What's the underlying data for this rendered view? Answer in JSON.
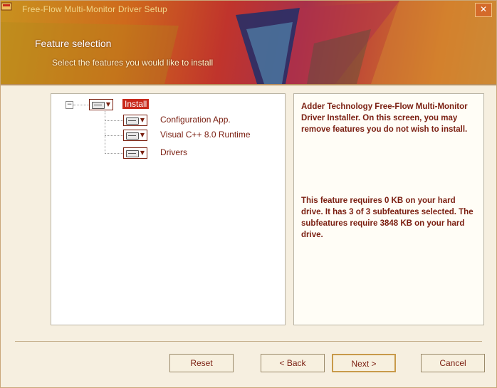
{
  "window": {
    "title": "Free-Flow Multi-Monitor Driver Setup",
    "close_label": "✕"
  },
  "banner": {
    "title": "Feature selection",
    "subtitle": "Select the features you would like to install"
  },
  "tree": {
    "root_label": "Install",
    "items": [
      {
        "label": "Configuration App."
      },
      {
        "label": "Visual C++ 8.0 Runtime"
      },
      {
        "label": "Drivers"
      }
    ]
  },
  "description": {
    "intro": "Adder Technology Free-Flow Multi-Monitor Driver Installer. On this screen, you may remove features you do not wish to install.",
    "requirements": "This feature requires 0 KB on your hard drive. It has 3 of 3 subfeatures selected. The subfeatures require 3848 KB on your hard drive."
  },
  "buttons": {
    "reset": "Reset",
    "back": "< Back",
    "next": "Next >",
    "cancel": "Cancel"
  },
  "colors": {
    "accent": "#c8281a",
    "text": "#7a1e10"
  }
}
